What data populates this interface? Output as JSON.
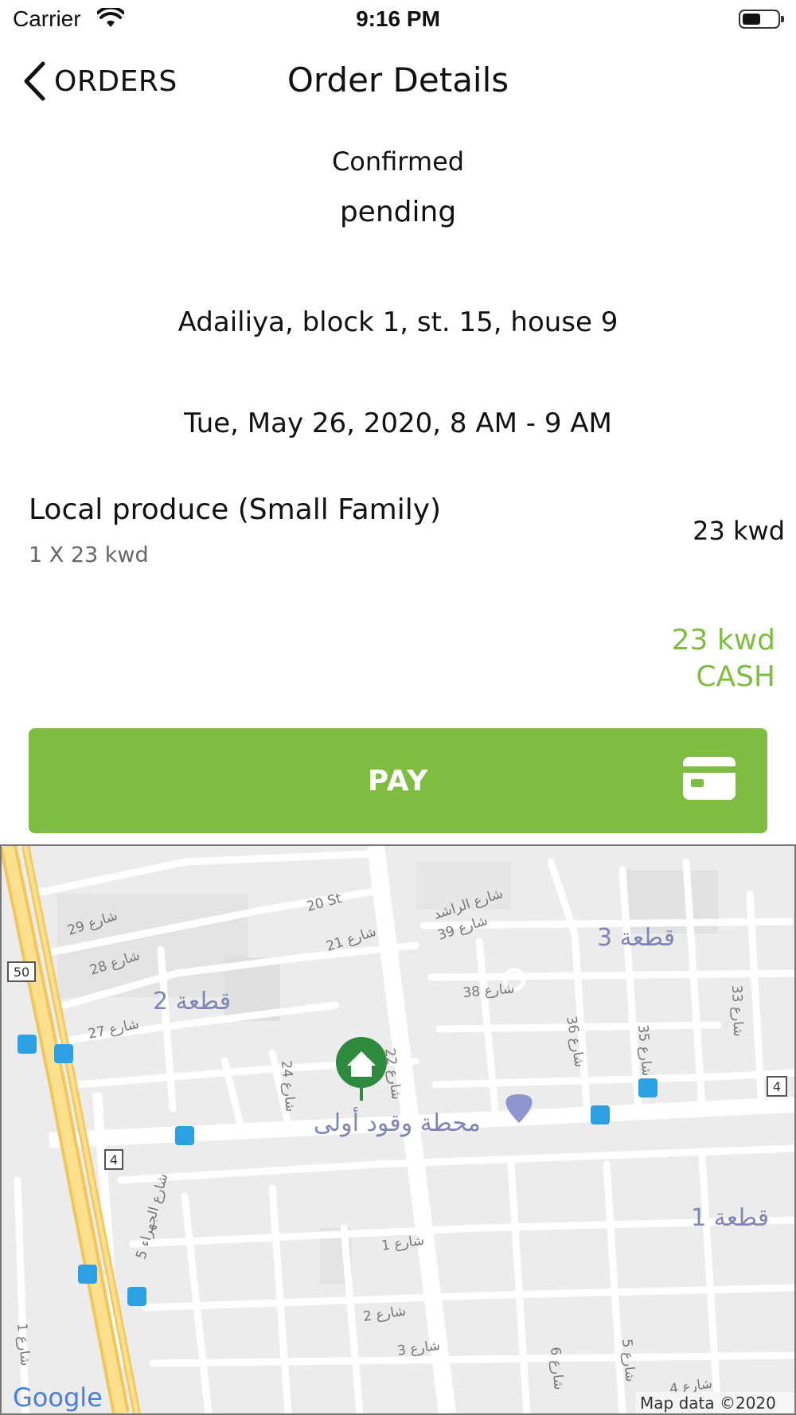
{
  "status_bar": {
    "carrier": "Carrier",
    "time": "9:16 PM"
  },
  "nav": {
    "back_label": "ORDERS",
    "title": "Order Details"
  },
  "order": {
    "status": "Confirmed",
    "sub_status": "pending",
    "address": "Adailiya, block 1, st. 15,  house 9",
    "delivery_slot": "Tue, May 26, 2020, 8 AM - 9 AM"
  },
  "items": [
    {
      "name": "Local produce (Small Family)",
      "quantity_line": "1 X 23 kwd",
      "price": "23 kwd"
    }
  ],
  "total": {
    "amount": "23 kwd",
    "payment_method": "CASH"
  },
  "pay_button": {
    "label": "PAY"
  },
  "map": {
    "labels": {
      "block_3": "قطعة 3",
      "block_2": "قطعة 2",
      "block_1": "قطعة 1",
      "station": "محطة وقود أولى",
      "st_20": "20 St",
      "st_29": "شارع 29",
      "st_28": "شارع 28",
      "st_27": "شارع 27",
      "st_21": "شارع 21",
      "st_rashed": "شارع الراشد",
      "st_39": "شارع 39",
      "st_38": "شارع 38",
      "st_36": "شارع 36",
      "st_35": "شارع 35",
      "st_33": "شارع 33",
      "st_24": "شارع 24",
      "st_22": "شارع 22",
      "st_1": "شارع 1",
      "st_2": "شارع 2",
      "st_3": "شارع 3",
      "st_4": "شارع 4",
      "st_5": "شارع 5",
      "st_6": "شارع 6",
      "st_jahra": "شارع الجهراء 5",
      "st_1b": "شارع 1",
      "shield_50": "50",
      "shield_4a": "4",
      "shield_4b": "4"
    },
    "google": "Google",
    "attribution": "Map data ©2020"
  },
  "colors": {
    "accent": "#7fbd41",
    "pin": "#2e8b3d"
  }
}
